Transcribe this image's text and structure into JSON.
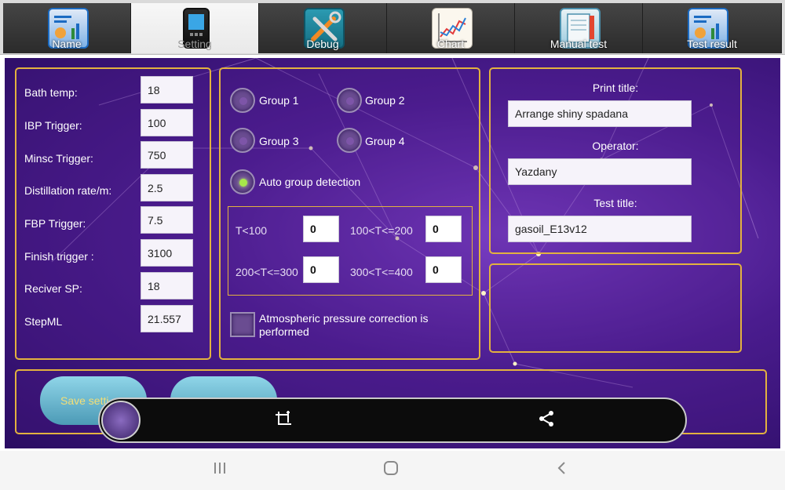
{
  "tabs": [
    {
      "label": "Name",
      "icon": "report-icon",
      "active": false
    },
    {
      "label": "Setting",
      "icon": "device-icon",
      "active": true
    },
    {
      "label": "Debug",
      "icon": "tools-icon",
      "active": false
    },
    {
      "label": "Chart",
      "icon": "line-chart-icon",
      "active": false
    },
    {
      "label": "Manual test",
      "icon": "notebook-pencil-icon",
      "active": false
    },
    {
      "label": "Test result",
      "icon": "report-icon",
      "active": false
    }
  ],
  "settings": [
    {
      "label": "Bath temp:",
      "value": "18"
    },
    {
      "label": "IBP Trigger:",
      "value": "100"
    },
    {
      "label": "Minsc Trigger:",
      "value": "750"
    },
    {
      "label": "Distillation rate/m:",
      "value": "2.5"
    },
    {
      "label": "FBP Trigger:",
      "value": "7.5"
    },
    {
      "label": "Finish trigger :",
      "value": "3100"
    },
    {
      "label": "Reciver SP:",
      "value": "18"
    },
    {
      "label": "StepML",
      "value": "21.557"
    }
  ],
  "groups": {
    "group1": "Group 1",
    "group2": "Group 2",
    "group3": "Group 3",
    "group4": "Group 4",
    "auto": "Auto group detection",
    "selected": "auto"
  },
  "thresholds": [
    {
      "label": "T<100",
      "value": "0"
    },
    {
      "label": "100<T<=200",
      "value": "0"
    },
    {
      "label": "200<T<=300",
      "value": "0"
    },
    {
      "label": "300<T<=400",
      "value": "0"
    }
  ],
  "atm_correction": {
    "label": "Atmospheric pressure correction is performed",
    "checked": false
  },
  "print": {
    "print_title_label": "Print title:",
    "print_title_value": "Arrange shiny spadana",
    "operator_label": "Operator:",
    "operator_value": "Yazdany",
    "test_title_label": "Test title:",
    "test_title_value": "gasoil_E13v12"
  },
  "buttons": {
    "save_settings": "Save setti"
  },
  "overlay": {
    "icons": [
      "thumbnail",
      "crop-edit-icon",
      "share-icon"
    ]
  },
  "system_nav": [
    "recent-apps-icon",
    "home-icon",
    "back-icon"
  ],
  "colors": {
    "panel_border": "#e3b23f",
    "button_text": "#f3de76",
    "radio_checked": "#a7e84a"
  }
}
